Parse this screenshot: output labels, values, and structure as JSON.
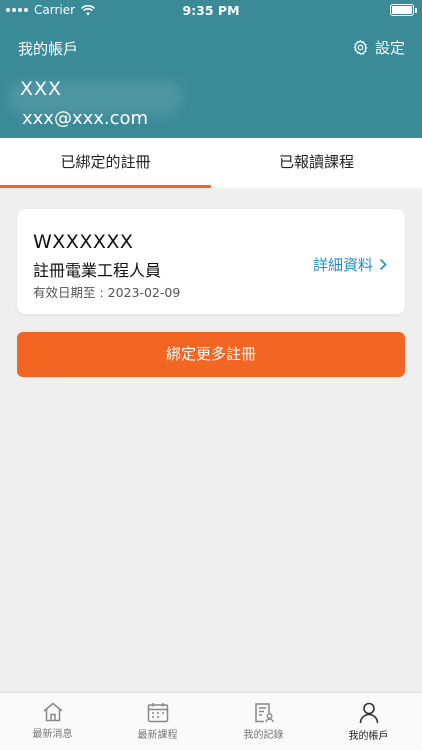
{
  "status_bar": {
    "carrier": "Carrier",
    "time": "9:35 PM"
  },
  "header": {
    "title": "我的帳戶",
    "settings_label": "設定",
    "user_name": "XXX",
    "user_email": "xxx@xxx.com"
  },
  "tabs": [
    {
      "label": "已綁定的註冊",
      "active": true
    },
    {
      "label": "已報讀課程",
      "active": false
    }
  ],
  "registration_card": {
    "id": "WXXXXXX",
    "type": "註冊電業工程人員",
    "expiry": "有效日期至 : 2023-02-09",
    "details_label": "詳細資料"
  },
  "bind_more_button": "綁定更多註冊",
  "bottom_nav": [
    {
      "label": "最新消息",
      "icon": "home-icon",
      "active": false
    },
    {
      "label": "最新課程",
      "icon": "calendar-icon",
      "active": false
    },
    {
      "label": "我的記錄",
      "icon": "record-icon",
      "active": false
    },
    {
      "label": "我的帳戶",
      "icon": "person-icon",
      "active": true
    }
  ],
  "colors": {
    "header": "#3a8a98",
    "accent": "#f26522",
    "link": "#1f8fd0"
  }
}
